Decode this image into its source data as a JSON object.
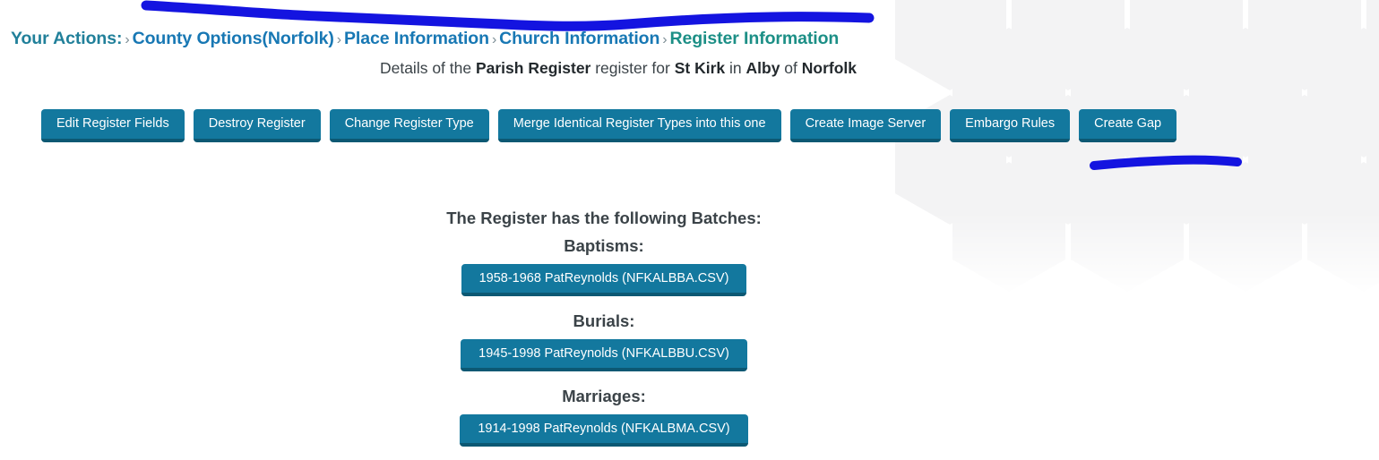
{
  "breadcrumb": {
    "label": "Your Actions:",
    "separator": "›",
    "items": [
      {
        "text": "County Options(Norfolk)",
        "current": false
      },
      {
        "text": "Place Information",
        "current": false
      },
      {
        "text": "Church Information",
        "current": false
      },
      {
        "text": "Register Information",
        "current": true
      }
    ]
  },
  "subtitle": {
    "prefix": "Details of the ",
    "register_type": "Parish Register",
    "mid1": " register for ",
    "church": "St Kirk",
    "mid2": " in ",
    "place": "Alby",
    "mid3": " of ",
    "county": "Norfolk"
  },
  "actions": [
    {
      "label": "Edit Register Fields"
    },
    {
      "label": "Destroy Register"
    },
    {
      "label": "Change Register Type"
    },
    {
      "label": "Merge Identical Register Types into this one"
    },
    {
      "label": "Create Image Server"
    },
    {
      "label": "Embargo Rules"
    },
    {
      "label": "Create Gap"
    }
  ],
  "batches": {
    "title": "The Register has the following Batches:",
    "groups": [
      {
        "title": "Baptisms:",
        "entries": [
          {
            "label": "1958-1968 PatReynolds (NFKALBBA.CSV)"
          }
        ]
      },
      {
        "title": "Burials:",
        "entries": [
          {
            "label": "1945-1998 PatReynolds (NFKALBBU.CSV)"
          }
        ]
      },
      {
        "title": "Marriages:",
        "entries": [
          {
            "label": "1914-1998 PatReynolds (NFKALBMA.CSV)"
          }
        ]
      }
    ]
  },
  "colors": {
    "button_face": "#13789e",
    "button_shadow": "#0c5873",
    "breadcrumb_label": "#21809a",
    "breadcrumb_link": "#1878b4",
    "breadcrumb_current": "#1c8f86",
    "heading_text": "#3b4348",
    "annotation_ink": "#1414e0",
    "hexagon_fill": "#f4f4f5",
    "page_background": "#ffffff"
  },
  "annotations": [
    {
      "name": "breadcrumb-underline-stroke"
    },
    {
      "name": "toolbar-right-underline-stroke"
    }
  ]
}
